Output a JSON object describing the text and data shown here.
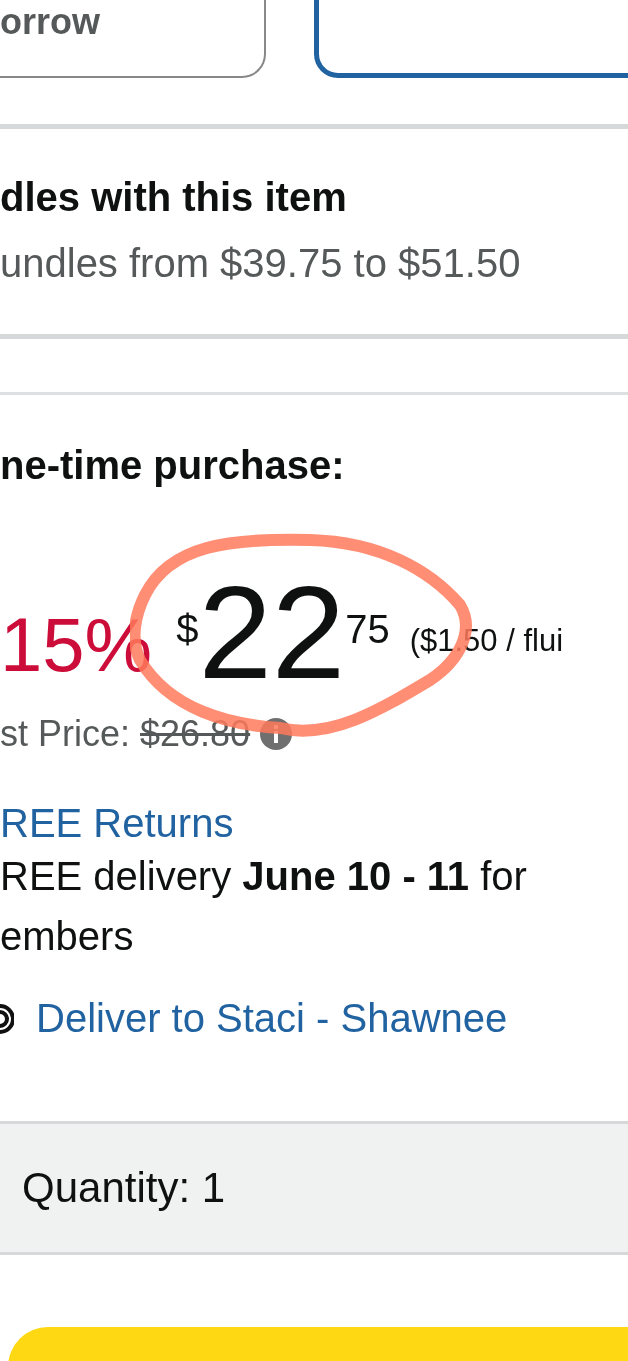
{
  "format_options": [
    {
      "label": "orrow",
      "selected": false
    },
    {
      "selected": true
    }
  ],
  "bundles": {
    "title": "dles with this item",
    "subtitle": "undles from $39.75 to $51.50"
  },
  "offer": {
    "heading": "ne-time purchase:",
    "discount": "15%",
    "price": {
      "symbol": "$",
      "whole": "22",
      "fraction": "75"
    },
    "unit_price": "($1.50 / flui",
    "list_price_label": "st Price:",
    "list_price": "$26.80"
  },
  "returns_link": "REE Returns",
  "delivery_lines": [
    "REE delivery **June 10 - 11** for",
    "embers"
  ],
  "deliver_to": "Deliver to Staci - Shawnee",
  "quantity": {
    "label": "Quantity:",
    "value": "1"
  },
  "annotation": {
    "kind": "circle",
    "color": "#ff7a5c"
  }
}
